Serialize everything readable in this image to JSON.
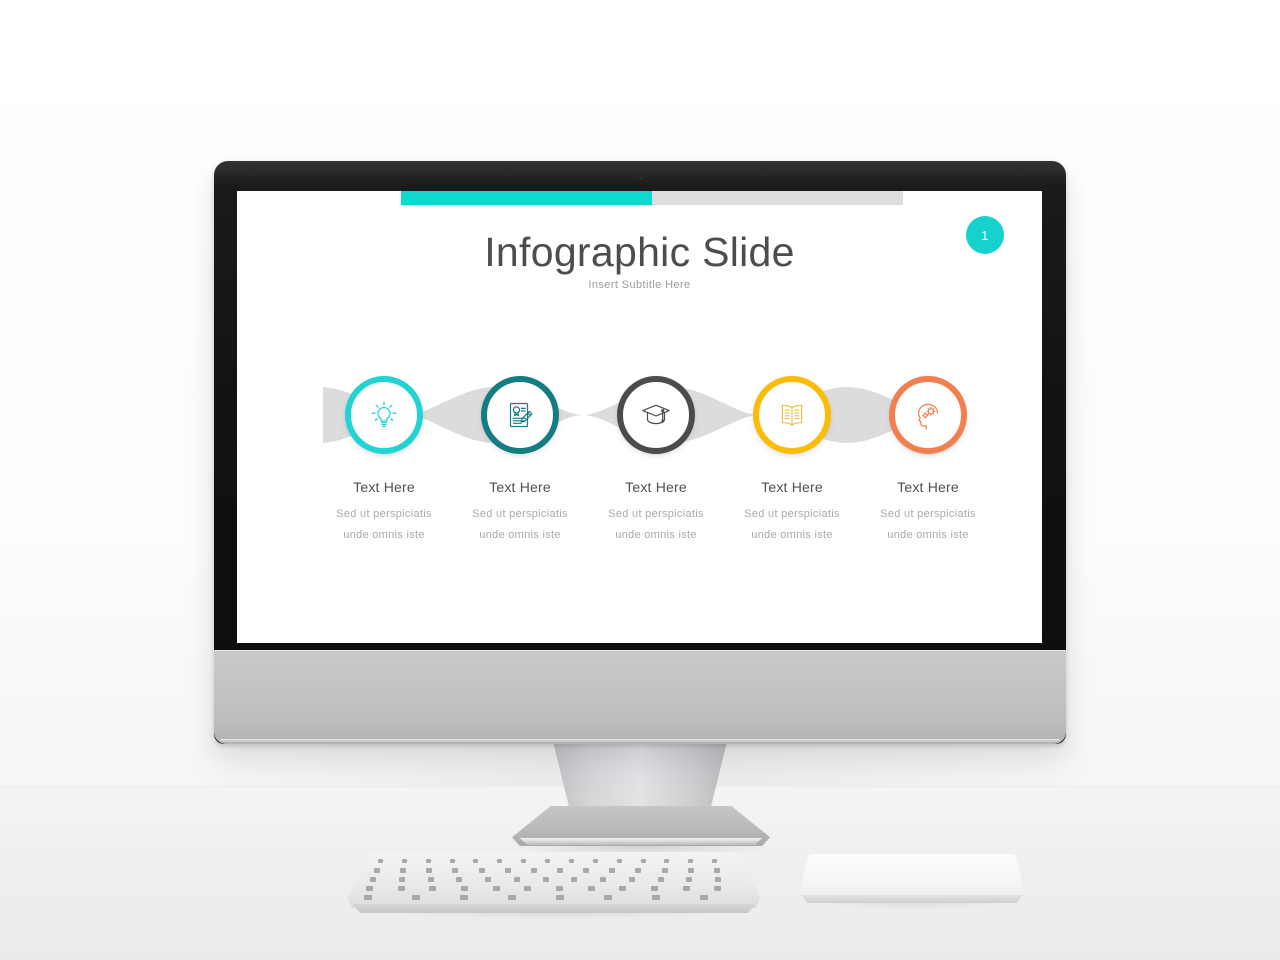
{
  "scene": {
    "device": "desktop-monitor",
    "background_color": "#fbfbfb",
    "desk_color": "#efeff0"
  },
  "slide": {
    "title": "Infographic Slide",
    "subtitle": "Insert Subtitle Here",
    "page_number": "1",
    "accent_color": "#16d2ce",
    "progress": {
      "percent": 50,
      "fill_color": "#0fd9cf",
      "track_color": "#dedede"
    },
    "connector_color": "#dcdcdc",
    "steps": [
      {
        "icon": "lightbulb-icon",
        "color": "#22d3d3",
        "title": "Text Here",
        "line1": "Sed ut perspiciatis",
        "line2": "unde omnis iste"
      },
      {
        "icon": "document-pencil-icon",
        "color": "#137d81",
        "title": "Text Here",
        "line1": "Sed ut perspiciatis",
        "line2": "unde omnis iste"
      },
      {
        "icon": "graduation-cap-icon",
        "color": "#4c4c4c",
        "title": "Text Here",
        "line1": "Sed ut perspiciatis",
        "line2": "unde omnis iste"
      },
      {
        "icon": "open-book-icon",
        "color": "#fbbc05",
        "title": "Text Here",
        "line1": "Sed ut perspiciatis",
        "line2": "unde omnis iste"
      },
      {
        "icon": "head-gears-icon",
        "color": "#f08050",
        "title": "Text Here",
        "line1": "Sed ut perspiciatis",
        "line2": "unde omnis iste"
      }
    ]
  }
}
